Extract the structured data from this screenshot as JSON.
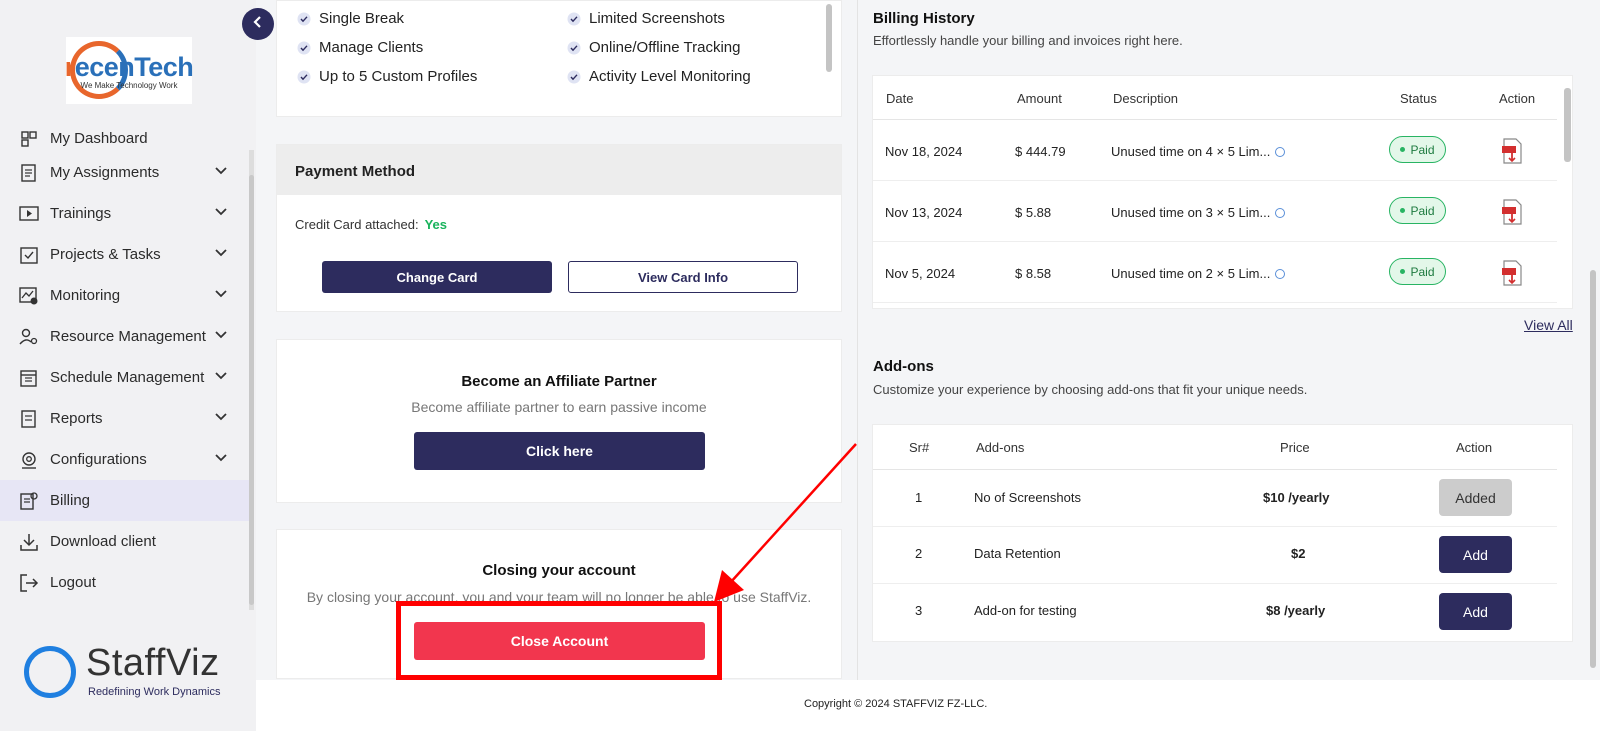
{
  "sidebar": {
    "logo": {
      "brand": "recenTech",
      "brand_first_letter": "r",
      "brand_rest": "ecenTech",
      "tagline": "We Make Technology Work"
    },
    "items": [
      {
        "label": "My Dashboard"
      },
      {
        "label": "My Assignments"
      },
      {
        "label": "Trainings"
      },
      {
        "label": "Projects & Tasks"
      },
      {
        "label": "Monitoring"
      },
      {
        "label": "Resource Management"
      },
      {
        "label": "Schedule Management"
      },
      {
        "label": "Reports"
      },
      {
        "label": "Configurations"
      },
      {
        "label": "Billing"
      },
      {
        "label": "Download client"
      },
      {
        "label": "Logout"
      }
    ],
    "brand": {
      "name": "StaffViz",
      "tagline": "Redefining Work Dynamics"
    }
  },
  "features": {
    "left": [
      "Single Break",
      "Manage Clients",
      "Up to 5 Custom Profiles"
    ],
    "right": [
      "Limited Screenshots",
      "Online/Offline Tracking",
      "Activity Level Monitoring"
    ]
  },
  "payment": {
    "title": "Payment Method",
    "cc_label": "Credit Card attached:",
    "cc_value": "Yes",
    "change_card": "Change Card",
    "view_card": "View Card Info"
  },
  "affiliate": {
    "title": "Become an Affiliate Partner",
    "subtitle": "Become affiliate partner to earn passive income",
    "button": "Click here"
  },
  "closing": {
    "title": "Closing your account",
    "subtitle": "By closing your account, you and your team will no longer be able to use StaffViz.",
    "button": "Close Account"
  },
  "billing": {
    "title": "Billing History",
    "subtitle": "Effortlessly handle your billing and invoices right here.",
    "headers": {
      "date": "Date",
      "amount": "Amount",
      "description": "Description",
      "status": "Status",
      "action": "Action"
    },
    "rows": [
      {
        "date": "Nov 18, 2024",
        "amount": "$ 444.79",
        "description": "Unused time on 4 × 5 Lim...",
        "status": "Paid"
      },
      {
        "date": "Nov 13, 2024",
        "amount": "$ 5.88",
        "description": "Unused time on 3 × 5 Lim...",
        "status": "Paid"
      },
      {
        "date": "Nov 5, 2024",
        "amount": "$ 8.58",
        "description": "Unused time on 2 × 5 Lim...",
        "status": "Paid"
      }
    ],
    "view_all": "View All"
  },
  "addons": {
    "title": "Add-ons",
    "subtitle": "Customize your experience by choosing add-ons that fit your unique needs.",
    "headers": {
      "sr": "Sr#",
      "name": "Add-ons",
      "price": "Price",
      "action": "Action"
    },
    "rows": [
      {
        "sr": "1",
        "name": "No of Screenshots",
        "price": "$10 /yearly",
        "action": "Added"
      },
      {
        "sr": "2",
        "name": "Data Retention",
        "price": "$2",
        "action": "Add"
      },
      {
        "sr": "3",
        "name": "Add-on for testing",
        "price": "$8 /yearly",
        "action": "Add"
      }
    ]
  },
  "footer": {
    "copyright": "Copyright © 2024 STAFFVIZ FZ-LLC."
  },
  "colors": {
    "primary": "#2d2c5e",
    "danger": "#f2364e",
    "success": "#19b35c",
    "annotation": "#ff0000"
  }
}
